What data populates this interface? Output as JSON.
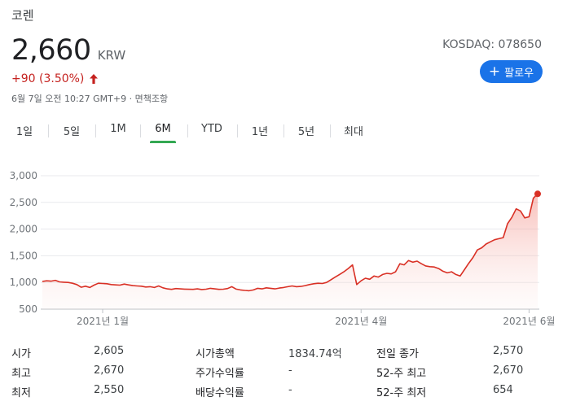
{
  "company": {
    "name": "코렌",
    "price": "2,660",
    "currency": "KRW",
    "change": "+90 (3.50%)",
    "timestamp": "6월 7일 오전 10:27 GMT+9 · 면책조항",
    "exchange": "KOSDAQ: 078650",
    "follow_label": "팔로우"
  },
  "tabs": [
    {
      "label": "1일",
      "active": false
    },
    {
      "label": "5일",
      "active": false
    },
    {
      "label": "1M",
      "active": false
    },
    {
      "label": "6M",
      "active": true
    },
    {
      "label": "YTD",
      "active": false
    },
    {
      "label": "1년",
      "active": false
    },
    {
      "label": "5년",
      "active": false
    },
    {
      "label": "최대",
      "active": false
    }
  ],
  "chart_data": {
    "type": "area",
    "y_ticks": [
      "3,000",
      "2,500",
      "2,000",
      "1,500",
      "1,000",
      "500"
    ],
    "x_tick_labels": [
      "2021년 1월",
      "2021년 4월",
      "2021년 6월"
    ],
    "ylim": [
      500,
      3000
    ],
    "grid": true,
    "line_color": "#d93025",
    "fill_color": "#f7c7c3",
    "values": [
      1020,
      1030,
      1025,
      1040,
      1010,
      1005,
      1000,
      985,
      960,
      910,
      930,
      905,
      950,
      985,
      980,
      975,
      960,
      955,
      950,
      970,
      955,
      940,
      935,
      930,
      915,
      920,
      905,
      935,
      900,
      880,
      870,
      885,
      880,
      875,
      872,
      870,
      880,
      868,
      874,
      890,
      880,
      870,
      874,
      885,
      920,
      875,
      860,
      850,
      845,
      860,
      890,
      880,
      900,
      890,
      880,
      895,
      905,
      920,
      935,
      920,
      925,
      940,
      960,
      975,
      985,
      980,
      1000,
      1050,
      1100,
      1150,
      1200,
      1260,
      1330,
      960,
      1030,
      1080,
      1060,
      1120,
      1100,
      1150,
      1170,
      1160,
      1200,
      1350,
      1330,
      1410,
      1380,
      1400,
      1350,
      1310,
      1295,
      1290,
      1260,
      1210,
      1180,
      1200,
      1150,
      1120,
      1240,
      1360,
      1470,
      1610,
      1650,
      1720,
      1760,
      1800,
      1820,
      1840,
      2100,
      2220,
      2380,
      2340,
      2210,
      2230,
      2580,
      2660
    ]
  },
  "stats": [
    [
      {
        "label": "시가",
        "value": "2,605"
      },
      {
        "label": "시가총액",
        "value": "1834.74억"
      },
      {
        "label": "전일 종가",
        "value": "2,570"
      }
    ],
    [
      {
        "label": "최고",
        "value": "2,670"
      },
      {
        "label": "주가수익률",
        "value": "-"
      },
      {
        "label": "52-주 최고",
        "value": "2,670"
      }
    ],
    [
      {
        "label": "최저",
        "value": "2,550"
      },
      {
        "label": "배당수익률",
        "value": "-"
      },
      {
        "label": "52-주 최저",
        "value": "654"
      }
    ]
  ]
}
